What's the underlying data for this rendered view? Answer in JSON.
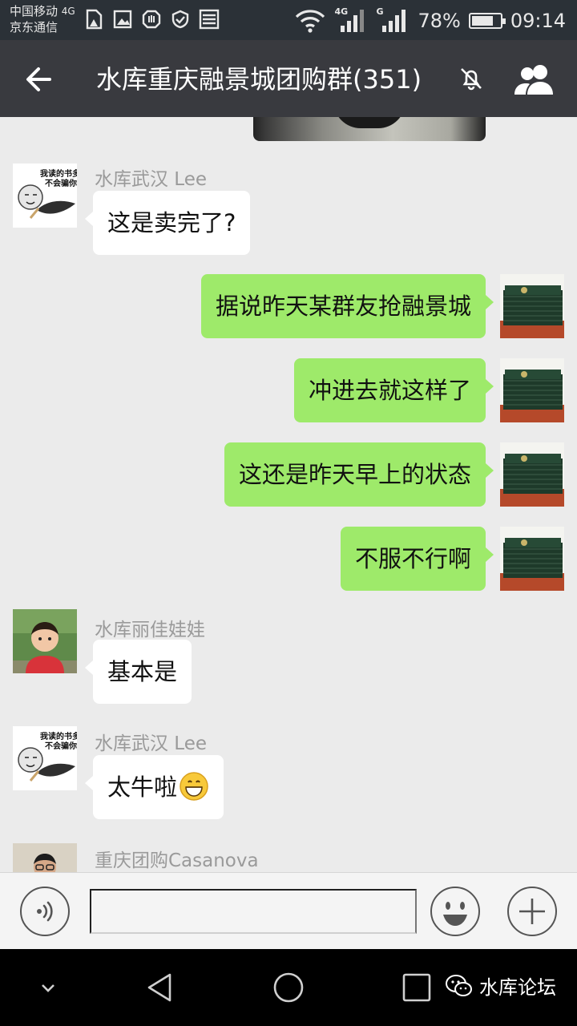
{
  "status_bar": {
    "carrier_line1": "中国移动",
    "carrier_net": "4G",
    "carrier_line2": "京东通信",
    "signal1_label": "4G",
    "signal2_label": "G",
    "battery_text": "78%",
    "battery_level": 0.78,
    "time": "09:14"
  },
  "header": {
    "title": "水库重庆融景城团购群(351)"
  },
  "messages": [
    {
      "side": "left",
      "sender": "水库武汉 Lee",
      "text": "这是卖完了?",
      "avatar": "meme-avatar"
    },
    {
      "side": "right",
      "text": "据说昨天某群友抢融景城",
      "avatar": "book-avatar"
    },
    {
      "side": "right",
      "text": "冲进去就这样了",
      "avatar": "book-avatar"
    },
    {
      "side": "right",
      "text": "这还是昨天早上的状态",
      "avatar": "book-avatar"
    },
    {
      "side": "right",
      "text": "不服不行啊",
      "avatar": "book-avatar"
    },
    {
      "side": "left",
      "sender": "水库丽佳娃娃",
      "text": "基本是",
      "avatar": "child-avatar"
    },
    {
      "side": "left",
      "sender": "水库武汉 Lee",
      "text": "太牛啦",
      "avatar": "meme-avatar",
      "emoji": "grinning-emoji"
    },
    {
      "side": "left",
      "sender": "重庆团购Casanova",
      "avatar": "person-avatar"
    }
  ],
  "meme_avatar_text": [
    "我读的书多",
    "不会骗你"
  ],
  "input": {
    "placeholder": ""
  },
  "watermark": {
    "text": "水库论坛"
  },
  "colors": {
    "title_bar": "#393a3f",
    "status_bar": "#2b3137",
    "chat_bg": "#ebebeb",
    "bubble_self": "#9eea6a",
    "bubble_other": "#ffffff"
  }
}
